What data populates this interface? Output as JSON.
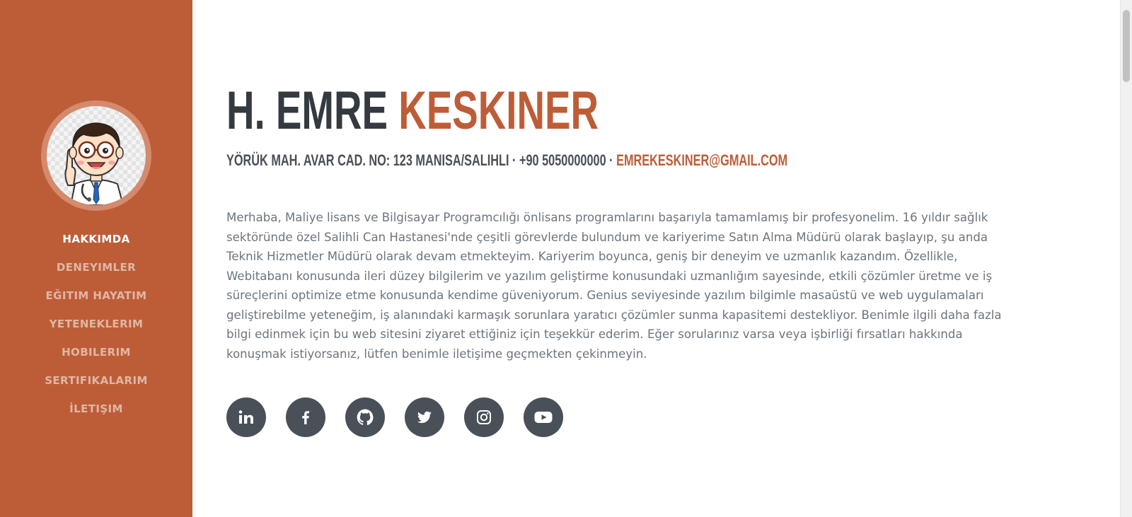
{
  "sidebar": {
    "avatar": "doctor-cartoon-avatar",
    "accent_color": "#bd5d38",
    "nav": [
      {
        "label": "HAKKIMDA",
        "active": true
      },
      {
        "label": "DENEYIMLER",
        "active": false
      },
      {
        "label": "EĞITIM HAYATIM",
        "active": false
      },
      {
        "label": "YETENEKLERIM",
        "active": false
      },
      {
        "label": "HOBILERIM",
        "active": false
      },
      {
        "label": "SERTIFIKALARIM",
        "active": false
      },
      {
        "label": "İLETIŞIM",
        "active": false
      }
    ]
  },
  "about": {
    "first_name": "H. EMRE",
    "last_name": "KESKINER",
    "address": "YÖRÜK MAH. AVAR CAD. NO: 123 MANISA/SALIHLI",
    "phone": "+90 5050000000",
    "separator": " · ",
    "email": "EMREKESKINER@GMAIL.COM",
    "lead": "Merhaba, Maliye lisans ve Bilgisayar Programcılığı önlisans programlarını başarıyla tamamlamış bir profesyonelim. 16 yıldır sağlık sektöründe özel Salihli Can Hastanesi'nde çeşitli görevlerde bulundum ve kariyerime Satın Alma Müdürü olarak başlayıp, şu anda Teknik Hizmetler Müdürü olarak devam etmekteyim. Kariyerim boyunca, geniş bir deneyim ve uzmanlık kazandım. Özellikle, Webitabanı konusunda ileri düzey bilgilerim ve yazılım geliştirme konusundaki uzmanlığım sayesinde, etkili çözümler üretme ve iş süreçlerini optimize etme konusunda kendime güveniyorum. Genius seviyesinde yazılım bilgimle masaüstü ve web uygulamaları geliştirebilme yeteneğim, iş alanındaki karmaşık sorunlara yaratıcı çözümler sunma kapasitemi destekliyor. Benimle ilgili daha fazla bilgi edinmek için bu web sitesini ziyaret ettiğiniz için teşekkür ederim. Eğer sorularınız varsa veya işbirliği fırsatları hakkında konuşmak istiyorsanız, lütfen benimle iletişime geçmekten çekinmeyin.",
    "social_icons": [
      "linkedin-icon",
      "facebook-icon",
      "github-icon",
      "twitter-icon",
      "instagram-icon",
      "youtube-icon"
    ]
  }
}
